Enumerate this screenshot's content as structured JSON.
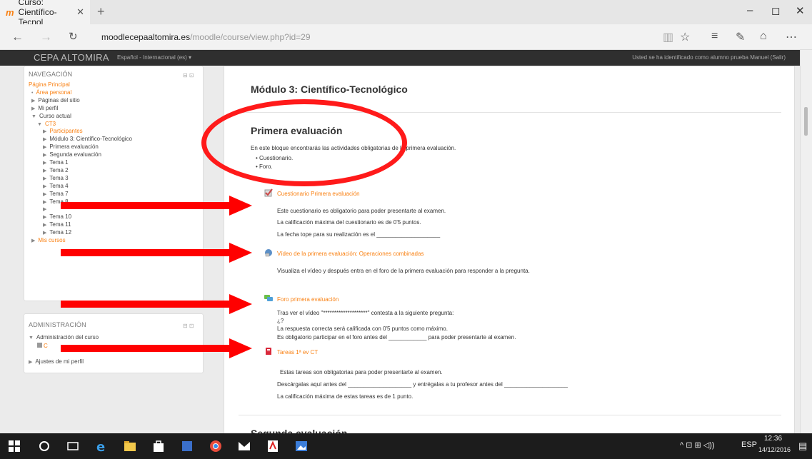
{
  "browser": {
    "tab_title": "Curso: Científico-Tecnol",
    "tab_logo": "m",
    "new_tab": "+",
    "url_host": "moodlecepaaltomira.es",
    "url_path": "/moodle/course/view.php?id=29",
    "minimize": "–",
    "maximize": "◻",
    "close": "✕"
  },
  "moodle_header": {
    "site_name": "CEPA ALTOMIRA",
    "language": "Español - Internacional (es) ▾",
    "user_text": "Usted se ha identificado como alumno prueba Manuel (Salir)"
  },
  "navigation": {
    "title": "NAVEGACIÓN",
    "controls": "⊟ ⊡",
    "items": [
      {
        "label": "Página Principal",
        "indent": 0,
        "tri": "",
        "orange": true
      },
      {
        "label": "Área personal",
        "indent": 1,
        "tri": "•",
        "orange": true
      },
      {
        "label": "Páginas del sitio",
        "indent": 1,
        "tri": "▶",
        "orange": false
      },
      {
        "label": "Mi perfil",
        "indent": 1,
        "tri": "▶",
        "orange": false
      },
      {
        "label": "Curso actual",
        "indent": 1,
        "tri": "▼",
        "orange": false
      },
      {
        "label": "CT3",
        "indent": 2,
        "tri": "▼",
        "orange": true
      },
      {
        "label": "Participantes",
        "indent": 3,
        "tri": "▶",
        "orange": true
      },
      {
        "label": "Módulo 3: Científico-Tecnológico",
        "indent": 3,
        "tri": "▶",
        "orange": false
      },
      {
        "label": "Primera evaluación",
        "indent": 3,
        "tri": "▶",
        "orange": false
      },
      {
        "label": "Segunda evaluación",
        "indent": 3,
        "tri": "▶",
        "orange": false
      },
      {
        "label": "Tema 1",
        "indent": 3,
        "tri": "▶",
        "orange": false
      },
      {
        "label": "Tema 2",
        "indent": 3,
        "tri": "▶",
        "orange": false
      },
      {
        "label": "Tema 3",
        "indent": 3,
        "tri": "▶",
        "orange": false
      },
      {
        "label": "Tema 4",
        "indent": 3,
        "tri": "▶",
        "orange": false
      },
      {
        "label": "Tema 7",
        "indent": 3,
        "tri": "▶",
        "orange": false
      },
      {
        "label": "Tema 8",
        "indent": 3,
        "tri": "▶",
        "orange": false
      },
      {
        "label": "",
        "indent": 3,
        "tri": "▶",
        "orange": false
      },
      {
        "label": "Tema 10",
        "indent": 3,
        "tri": "▶",
        "orange": false
      },
      {
        "label": "Tema 11",
        "indent": 3,
        "tri": "▶",
        "orange": false
      },
      {
        "label": "Tema 12",
        "indent": 3,
        "tri": "▶",
        "orange": false
      },
      {
        "label": "Mis cursos",
        "indent": 1,
        "tri": "▶",
        "orange": true
      }
    ]
  },
  "administration": {
    "title": "ADMINISTRACIÓN",
    "controls": "⊟ ⊡",
    "course_admin": "Administración del curso",
    "sub_item": "C",
    "profile_settings": "Ajustes de mi perfil"
  },
  "main": {
    "module_title": "Módulo 3: Científico-Tecnológico",
    "section1_title": "Primera evaluación",
    "section1_desc": "En este bloque encontrarás las actividades obligatorias de la primera evaluación.",
    "section1_bullets": [
      "Cuestionario.",
      "Foro."
    ],
    "activities": [
      {
        "name": "Cuestionario Primera evaluación",
        "icon": "quiz-icon",
        "lines": [
          "Este cuestionario es obligatorio para poder presentarte al examen.",
          "La calificación máxima del cuestionario es de 0'5 puntos.",
          "La fecha tope para su realización es el ____________________"
        ]
      },
      {
        "name": "Vídeo de la primera evaluación: Operaciones combinadas",
        "icon": "url-icon",
        "lines": [
          "Visualiza el vídeo y después entra en el foro de la primera evaluación para responder a la pregunta."
        ]
      },
      {
        "name": "Foro primera evaluación",
        "icon": "forum-icon",
        "lines": [
          "Tras ver el vídeo \"********************\" contesta a la siguiente pregunta:",
          "¿?",
          "La respuesta correcta será calificada con 0'5 puntos como máximo.",
          "Es obligatorio participar en el foro antes del ____________ para poder presentarte al examen."
        ]
      },
      {
        "name": "Tareas 1ª ev CT",
        "icon": "assignment-icon",
        "lines": [
          "Estas tareas son obligatorias para poder presentarte al examen.",
          "Descárgalas aquí antes del ____________________ y entrégalas a tu profesor antes del ____________________",
          "La calificación máxima de estas tareas es de 1 punto."
        ]
      }
    ],
    "section2_title": "Segunda evaluación"
  },
  "taskbar": {
    "time": "12:36",
    "date": "14/12/2016",
    "lang": "ESP",
    "tray_icons": "^ ⊡ ⊞ ◁))"
  },
  "colors": {
    "moodle_orange": "#f98012",
    "annotation_red": "#ff0000",
    "header_dark": "#2f2f2f"
  }
}
